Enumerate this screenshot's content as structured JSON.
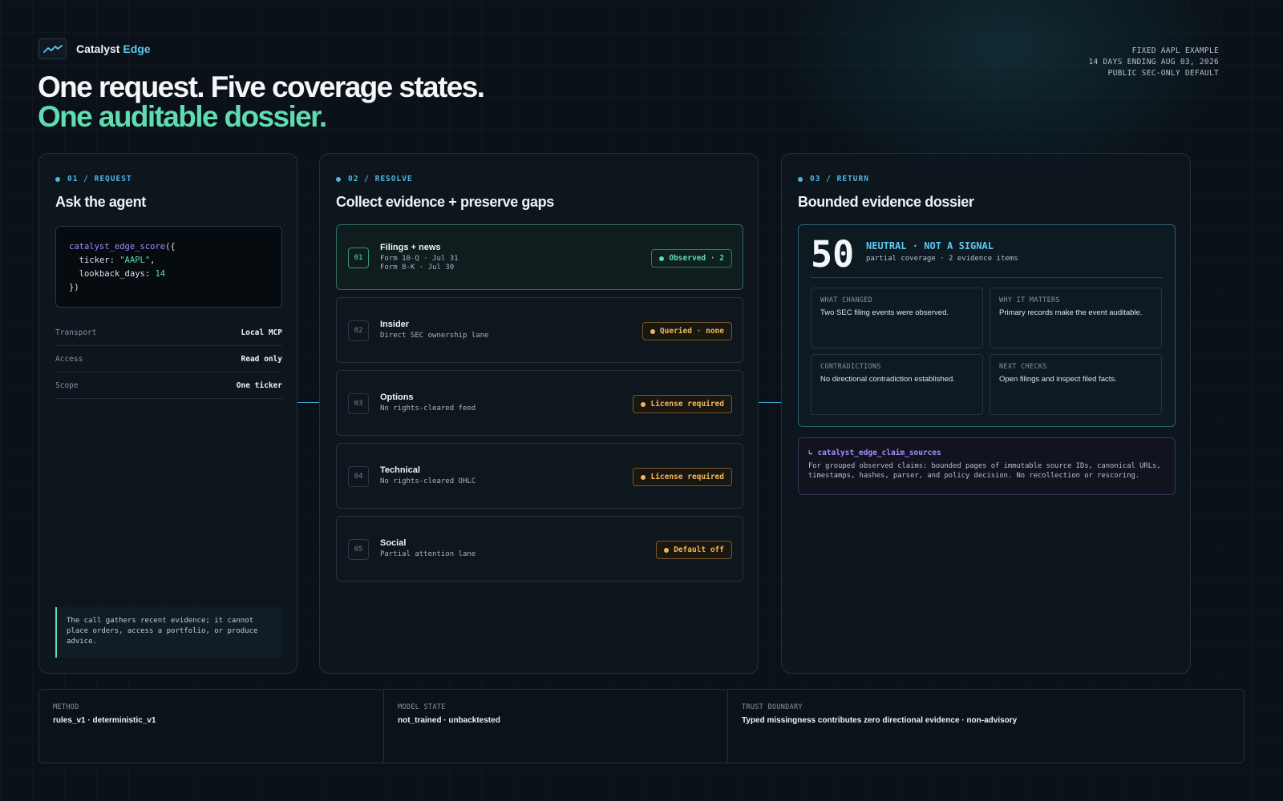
{
  "brand": {
    "name": "Catalyst",
    "accent": "Edge",
    "logo_icon": "trend-line-icon"
  },
  "meta": [
    "FIXED AAPL EXAMPLE",
    "14 DAYS ENDING AUG 03, 2026",
    "PUBLIC SEC-ONLY DEFAULT"
  ],
  "hero": {
    "line1": "One request. Five coverage states.",
    "line2": "One auditable dossier."
  },
  "request": {
    "step": "01 / REQUEST",
    "title": "Ask the agent",
    "code": {
      "fn": "catalyst_edge_score",
      "open": "({",
      "ticker_key": "ticker: ",
      "ticker_val": "\"AAPL\"",
      "ticker_tail": ",",
      "lookback_key": "lookback_days: ",
      "lookback_val": "14",
      "close": "})"
    },
    "props": [
      {
        "key": "Transport",
        "value": "Local MCP"
      },
      {
        "key": "Access",
        "value": "Read only"
      },
      {
        "key": "Scope",
        "value": "One ticker"
      }
    ],
    "note": "The call gathers recent evidence; it cannot place orders, access a portfolio, or produce advice."
  },
  "resolve": {
    "step": "02 / RESOLVE",
    "title": "Collect evidence + preserve gaps",
    "lanes": [
      {
        "num": "01",
        "name": "Filings + news",
        "sub1": "Form 10-Q · Jul 31",
        "sub2": "Form 8-K · Jul 30",
        "badge": "Observed · 2",
        "status": "ok"
      },
      {
        "num": "02",
        "name": "Insider",
        "sub1": "Direct SEC ownership lane",
        "sub2": "",
        "badge": "Queried · none",
        "status": "warn"
      },
      {
        "num": "03",
        "name": "Options",
        "sub1": "No rights-cleared feed",
        "sub2": "",
        "badge": "License required",
        "status": "warn"
      },
      {
        "num": "04",
        "name": "Technical",
        "sub1": "No rights-cleared OHLC",
        "sub2": "",
        "badge": "License required",
        "status": "warn"
      },
      {
        "num": "05",
        "name": "Social",
        "sub1": "Partial attention lane",
        "sub2": "",
        "badge": "Default off",
        "status": "warn"
      }
    ]
  },
  "return": {
    "step": "03 / RETURN",
    "title": "Bounded evidence dossier",
    "score": "50",
    "verdict": "NEUTRAL · NOT A SIGNAL",
    "coverage": "partial coverage · 2 evidence items",
    "cells": [
      {
        "head": "WHAT CHANGED",
        "body": "Two SEC filing events were observed."
      },
      {
        "head": "WHY IT MATTERS",
        "body": "Primary records make the event auditable."
      },
      {
        "head": "CONTRADICTIONS",
        "body": "No directional contradiction established."
      },
      {
        "head": "NEXT CHECKS",
        "body": "Open filings and inspect filed facts."
      }
    ],
    "claims_title": "↳ catalyst_edge_claim_sources",
    "claims_desc": "For grouped observed claims: bounded pages of immutable source IDs, canonical URLs, timestamps, hashes, parser, and policy decision. No recollection or rescoring."
  },
  "footer": [
    {
      "key": "METHOD",
      "value": "rules_v1 · deterministic_v1"
    },
    {
      "key": "MODEL STATE",
      "value": "not_trained · unbacktested"
    },
    {
      "key": "TRUST BOUNDARY",
      "value": "Typed missingness contributes zero directional evidence · non-advisory"
    }
  ],
  "colors": {
    "accent": "#5ec8ef",
    "green": "#5fdcb0",
    "amber": "#f2b65a",
    "violet": "#a78bfa",
    "bg": "#0a1118"
  }
}
